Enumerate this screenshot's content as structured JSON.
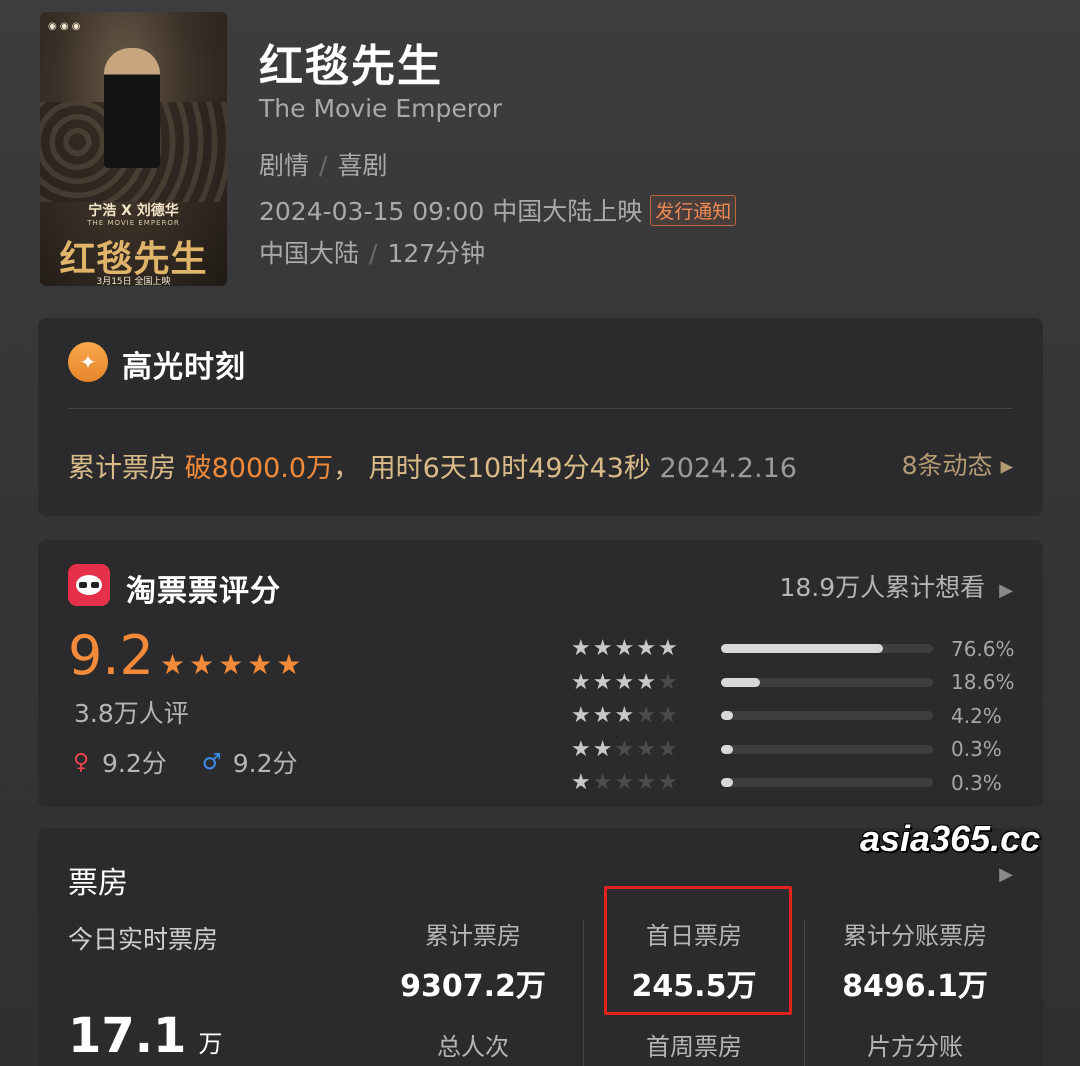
{
  "movie": {
    "title": "红毯先生",
    "english_title": "The Movie Emperor",
    "genres": [
      "剧情",
      "喜剧"
    ],
    "release": "2024-03-15 09:00 中国大陆上映",
    "release_tag": "发行通知",
    "region": "中国大陆",
    "duration": "127分钟",
    "poster": {
      "names": "宁浩 X 刘德华",
      "subtitle": "THE MOVIE EMPEROR",
      "title": "红毯先生",
      "date_text": "3月15日 全国上映"
    }
  },
  "highlights": {
    "title": "高光时刻",
    "label": "累计票房",
    "milestone": "破8000.0万",
    "comma": "，",
    "elapsed": "用时6天10时49分43秒",
    "date": "2024.2.16",
    "more": "8条动态 ▸"
  },
  "rating": {
    "title": "淘票票评分",
    "want": "18.9万人累计想看",
    "score": "9.2",
    "stars": "★★★★★",
    "count": "3.8万人评",
    "female_score": "9.2分",
    "male_score": "9.2分",
    "distribution": [
      {
        "stars": 5,
        "percent": 76.6,
        "label": "76.6%"
      },
      {
        "stars": 4,
        "percent": 18.6,
        "label": "18.6%"
      },
      {
        "stars": 3,
        "percent": 4.2,
        "label": "4.2%"
      },
      {
        "stars": 2,
        "percent": 0.3,
        "label": "0.3%"
      },
      {
        "stars": 1,
        "percent": 0.3,
        "label": "0.3%"
      }
    ]
  },
  "box_office": {
    "title": "票房",
    "today_label": "今日实时票房",
    "today_value": "17.1",
    "today_unit": "万",
    "columns": [
      {
        "label": "累计票房",
        "value": "9307.2万",
        "label2": "总人次"
      },
      {
        "label": "首日票房",
        "value": "245.5万",
        "label2": "首周票房"
      },
      {
        "label": "累计分账票房",
        "value": "8496.1万",
        "label2": "片方分账"
      }
    ]
  },
  "watermark": "asia365.cc",
  "colors": {
    "accent_orange": "#f28a3a",
    "gold_text": "#d9bb88",
    "highlight_box": "#e3241d"
  }
}
